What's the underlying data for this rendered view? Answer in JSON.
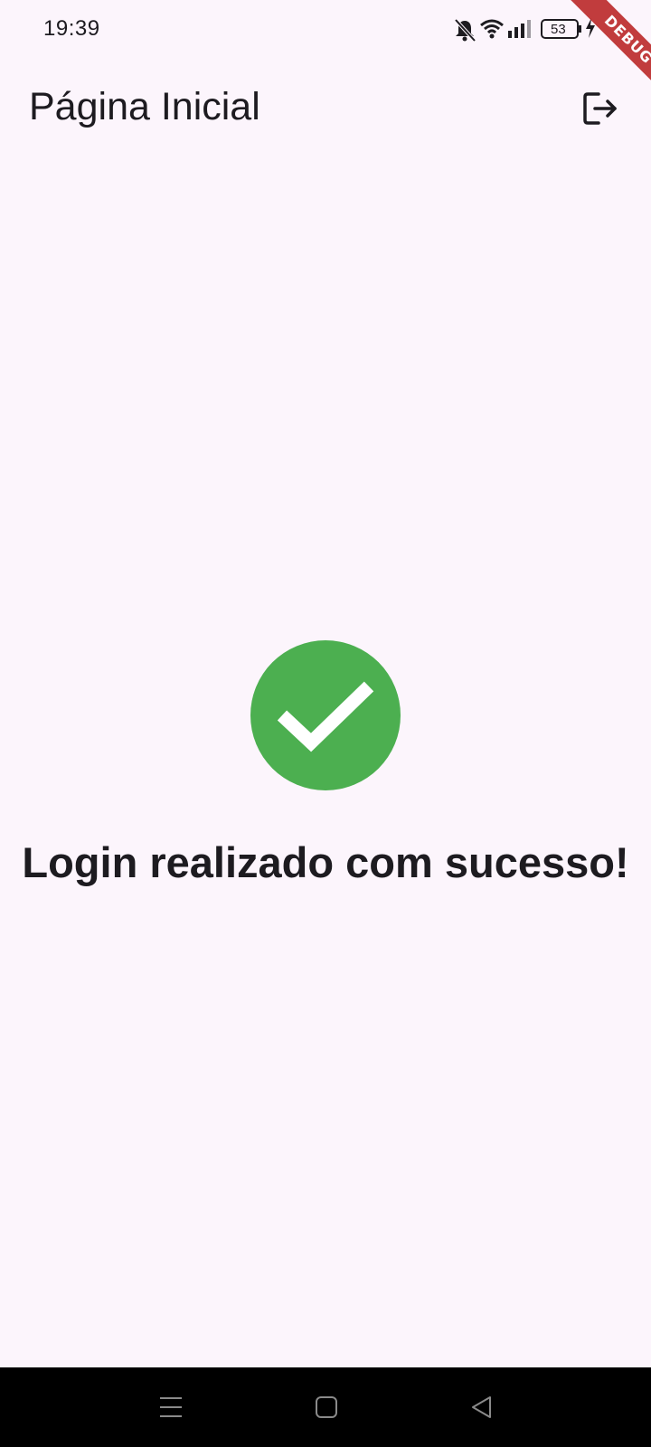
{
  "status_bar": {
    "time": "19:39",
    "battery_level": "53",
    "icons": [
      "bell-muted-icon",
      "wifi-icon",
      "signal-icon",
      "battery-icon",
      "charging-icon"
    ]
  },
  "debug_banner": {
    "label": "DEBUG"
  },
  "app_bar": {
    "title": "Página Inicial",
    "action_icon": "logout-icon"
  },
  "main": {
    "success_icon": "check-circle-icon",
    "message": "Login realizado com sucesso!"
  },
  "nav_bar": {
    "items": [
      "menu-icon",
      "home-icon",
      "back-icon"
    ]
  },
  "colors": {
    "background": "#fcf5fc",
    "success": "#4caf50",
    "text": "#1d1b20",
    "debug": "#b71c1c"
  }
}
